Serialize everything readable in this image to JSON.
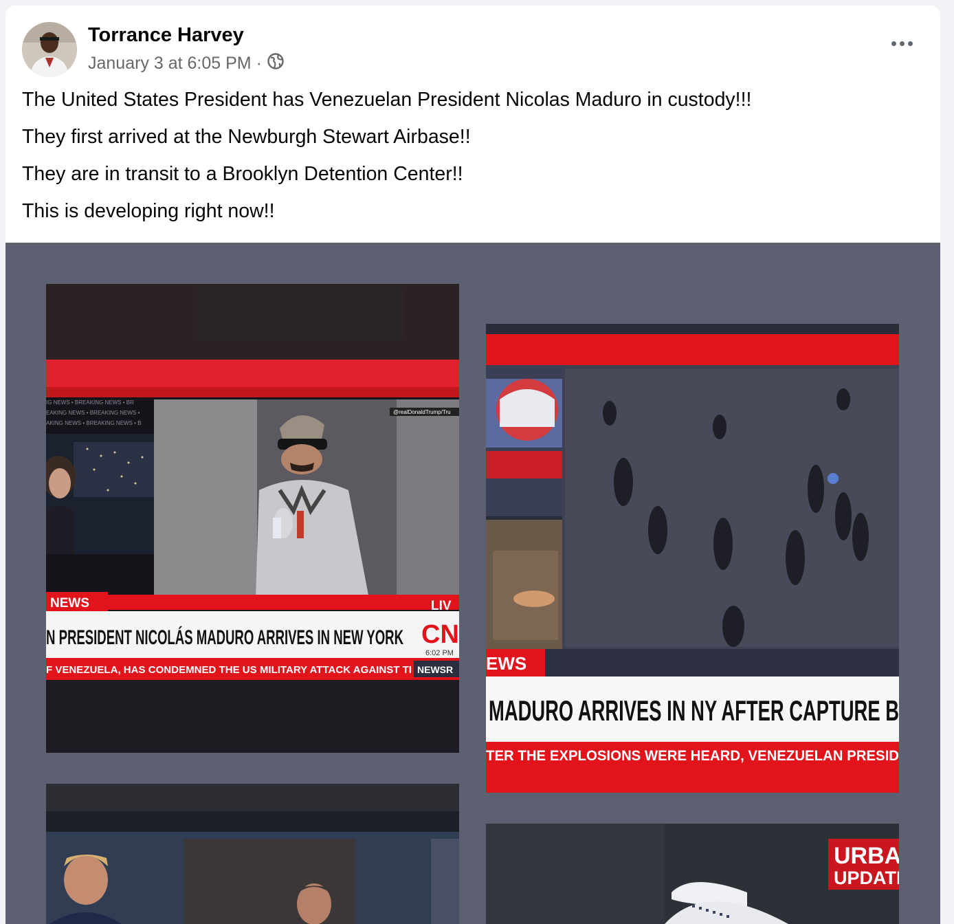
{
  "post": {
    "author": "Torrance Harvey",
    "timestamp": "January 3 at 6:05 PM",
    "separator": "·",
    "privacy_icon": "globe-icon",
    "more_icon": "more-options-icon",
    "lines": [
      "The United States President has Venezuelan President Nicolas Maduro in custody!!!",
      "They first arrived at the Newburgh Stewart Airbase!!",
      "They are in transit to a Brooklyn Detention Center!!",
      "This is developing right now!!"
    ]
  },
  "photos": {
    "p1": {
      "ticker_label": "NEWS",
      "live": "LIV",
      "headline": "N PRESIDENT NICOLÁS MADURO ARRIVES IN NEW YORK",
      "logo": "CN",
      "time": "6:02 PM",
      "crawl": "F VENEZUELA, HAS CONDEMNED THE US MILITARY ATTACK AGAINST TI",
      "crawl_tag": "NEWSR",
      "source": "@realDonaldTrump/Tru",
      "breaking_lines": [
        "IG NEWS • BREAKING NEWS • BR",
        "EAKING NEWS • BREAKING NEWS •",
        "AKING NEWS • BREAKING NEWS • B"
      ]
    },
    "p2": {
      "ticker_label": "EWS",
      "headline": "MADURO ARRIVES IN NY AFTER CAPTURE B",
      "crawl": "TER THE EXPLOSIONS WERE HEARD, VENEZUELAN PRESID"
    },
    "p4": {
      "badge_line1": "URBAN",
      "badge_line2": "UPDATEZ"
    }
  },
  "colors": {
    "accent_red": "#e31b23",
    "gallery_bg": "#5d6070",
    "meta_gray": "#65676b"
  }
}
